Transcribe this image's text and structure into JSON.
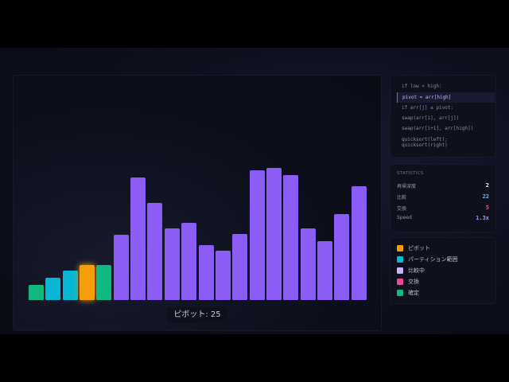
{
  "visualizer": {
    "bars": [
      {
        "value": 19,
        "state": "confirmed",
        "color": "#10b981"
      },
      {
        "value": 28,
        "state": "partition",
        "color": "#06b6d4"
      },
      {
        "value": 37,
        "state": "partition",
        "color": "#06b6d4"
      },
      {
        "value": 45,
        "state": "pivot",
        "color": "#f59e0b"
      },
      {
        "value": 45,
        "state": "confirmed",
        "color": "#10b981"
      },
      {
        "value": 83,
        "state": "default",
        "color": "#8b5cf6"
      },
      {
        "value": 156,
        "state": "default",
        "color": "#8b5cf6"
      },
      {
        "value": 123,
        "state": "default",
        "color": "#8b5cf6"
      },
      {
        "value": 91,
        "state": "default",
        "color": "#8b5cf6"
      },
      {
        "value": 98,
        "state": "default",
        "color": "#8b5cf6"
      },
      {
        "value": 70,
        "state": "default",
        "color": "#8b5cf6"
      },
      {
        "value": 63,
        "state": "default",
        "color": "#8b5cf6"
      },
      {
        "value": 84,
        "state": "default",
        "color": "#8b5cf6"
      },
      {
        "value": 165,
        "state": "default",
        "color": "#8b5cf6"
      },
      {
        "value": 168,
        "state": "default",
        "color": "#8b5cf6"
      },
      {
        "value": 159,
        "state": "default",
        "color": "#8b5cf6"
      },
      {
        "value": 91,
        "state": "default",
        "color": "#8b5cf6"
      },
      {
        "value": 75,
        "state": "default",
        "color": "#8b5cf6"
      },
      {
        "value": 109,
        "state": "default",
        "color": "#8b5cf6"
      },
      {
        "value": 145,
        "state": "default",
        "color": "#8b5cf6"
      }
    ],
    "pivot_label": "ピボット: 25"
  },
  "code": {
    "lines": [
      {
        "text": "if low < high:",
        "active": false
      },
      {
        "text": "pivot = arr[high]",
        "active": true
      },
      {
        "text": "if arr[j] ≤ pivot:",
        "active": false
      },
      {
        "text": "swap(arr[i], arr[j])",
        "active": false
      },
      {
        "text": "swap(arr[i+1], arr[high])",
        "active": false
      },
      {
        "text": "quicksort(left);",
        "active": false
      },
      {
        "text": "quicksort(right)",
        "active": false
      }
    ]
  },
  "stats": {
    "title": "STATISTICS",
    "rows": [
      {
        "label": "再帰深度",
        "value": "2",
        "color": "#ffffff"
      },
      {
        "label": "比較",
        "value": "22",
        "color": "#5ec8f0"
      },
      {
        "label": "交換",
        "value": "5",
        "color": "#f0568c"
      },
      {
        "label": "Speed",
        "value": "1.3x",
        "color": "#a78bfa"
      }
    ]
  },
  "legend": {
    "items": [
      {
        "label": "ピボット",
        "color": "#f59e0b"
      },
      {
        "label": "パーティション範囲",
        "color": "#06b6d4"
      },
      {
        "label": "比較中",
        "color": "#c4b5fd"
      },
      {
        "label": "交換",
        "color": "#ec4899"
      },
      {
        "label": "確定",
        "color": "#10b981"
      }
    ]
  }
}
